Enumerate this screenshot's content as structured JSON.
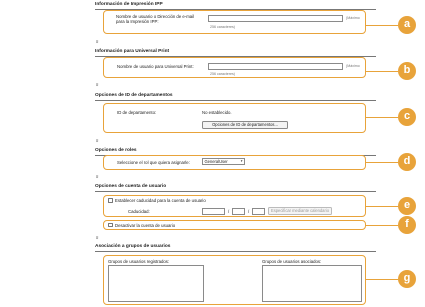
{
  "ipp": {
    "title": "Información de Impresión IPP",
    "field_label": "Nombre de usuario o Dirección de e-mail para la Impresión IPP:",
    "max_note": "(Máximo",
    "chars_note": "256 caracteres)"
  },
  "universal": {
    "title": "Información para Universal Print",
    "field_label": "Nombre de usuario para Universal Print:",
    "max_note": "(Máximo",
    "chars_note": "256 caracteres)"
  },
  "dept": {
    "title": "Opciones de ID de departamentos",
    "id_label": "ID de departamento:",
    "id_value": "No establecido.",
    "button_label": "Opciones de ID de departamentos..."
  },
  "roles": {
    "title": "Opciones de roles",
    "select_label": "Seleccione el rol que quiera asignarle:",
    "selected_role": "GeneralUser"
  },
  "account": {
    "title": "Opciones de cuenta de usuario",
    "expiry_checkbox_label": "Establecer caducidad para la cuenta de usuario",
    "expiry_label": "Caducidad:",
    "date_separator": "/",
    "calendar_button_label": "Especificar mediante calendario",
    "deactivate_label": "Desactivar la cuenta de usuario"
  },
  "groups": {
    "title": "Asociación a grupos de usuarios",
    "registered_label": "Grupos de usuarios registrados:",
    "associated_label": "Grupos de usuarios asociados:"
  },
  "anchor_glyph": "⌆",
  "badges": [
    "a",
    "b",
    "c",
    "d",
    "e",
    "f",
    "g"
  ],
  "colors": {
    "accent": "#e8a33a",
    "border": "#8a8a8a",
    "text": "#222222"
  }
}
